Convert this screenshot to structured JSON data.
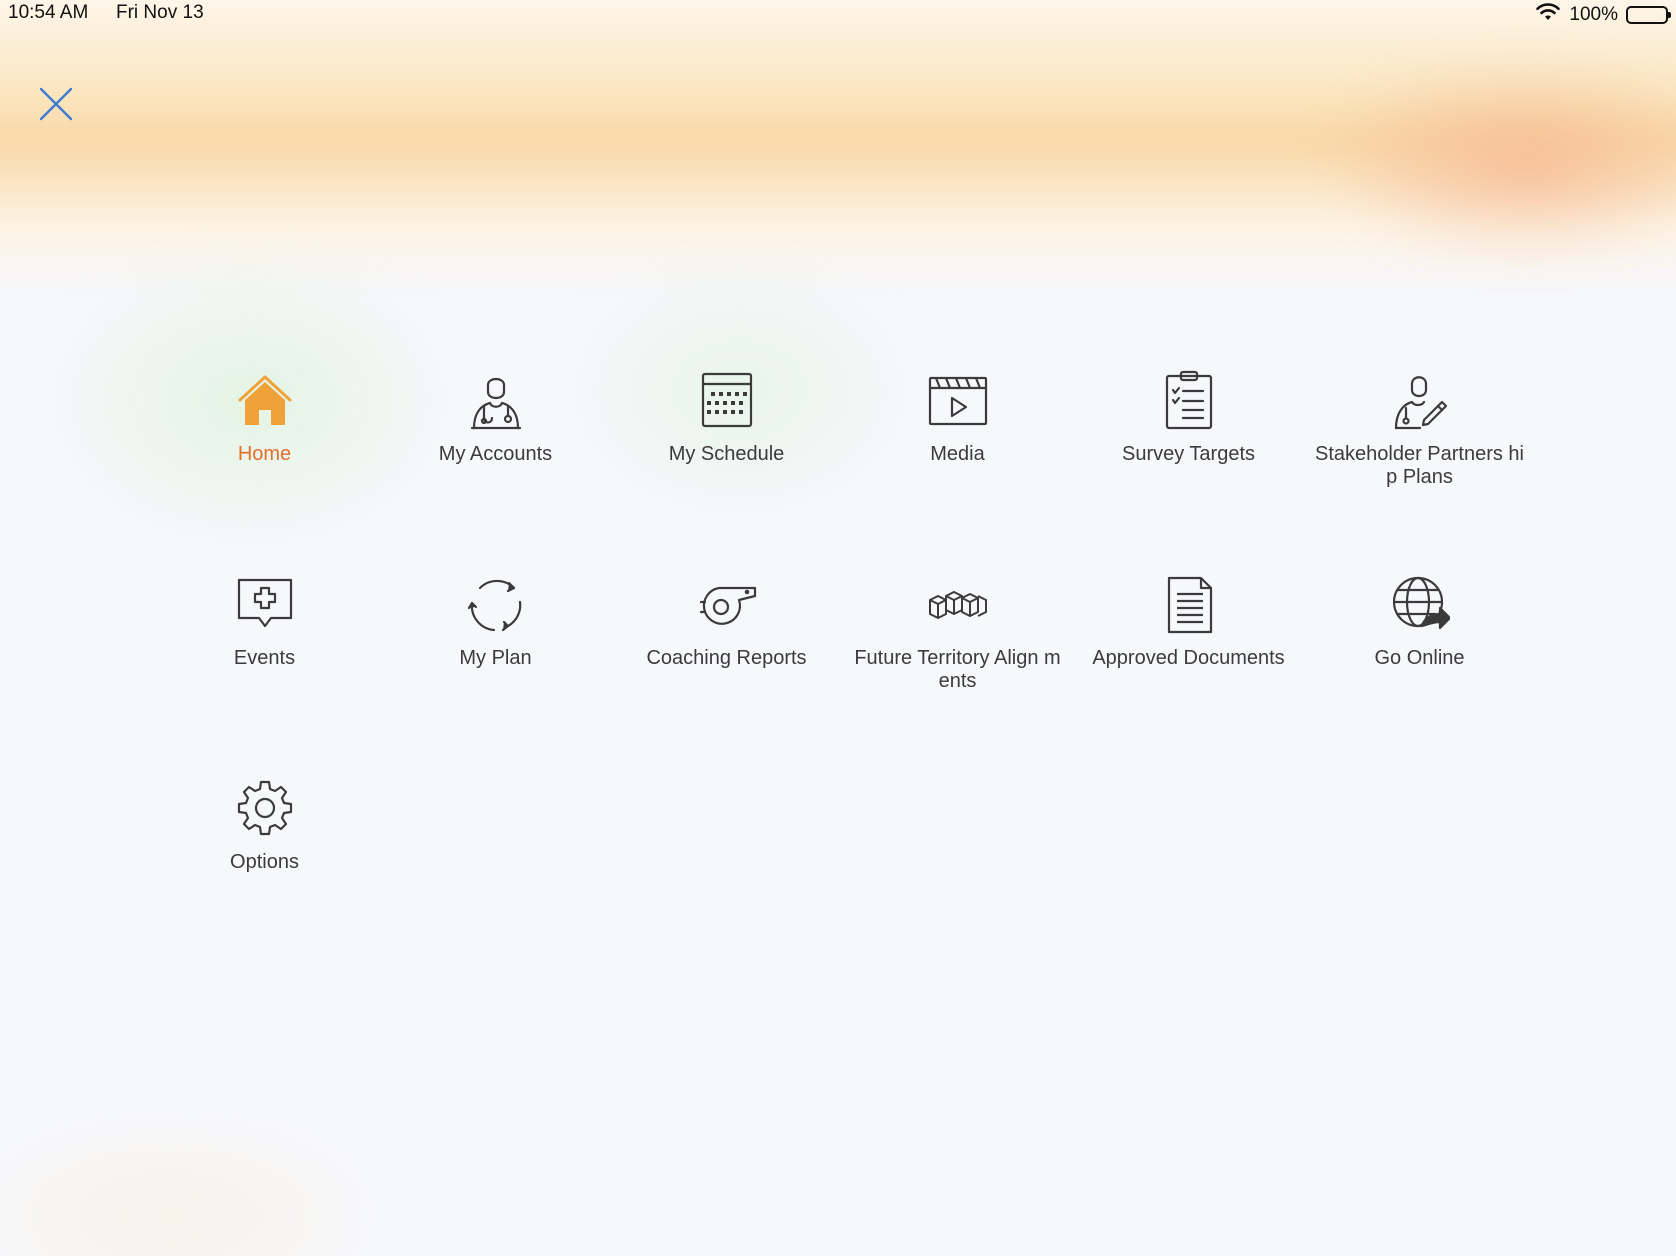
{
  "status_bar": {
    "time": "10:54 AM",
    "date": "Fri Nov 13",
    "battery": "100%"
  },
  "close_icon": "close-icon",
  "colors": {
    "active_label": "#e36f2b",
    "active_icon": "#f0a23a",
    "icon_stroke": "#3b3b3b",
    "close_icon": "#3a7bd5"
  },
  "menu": {
    "items": [
      {
        "label": "Home",
        "icon": "home-icon",
        "active": true
      },
      {
        "label": "My Accounts",
        "icon": "doctor-icon"
      },
      {
        "label": "My Schedule",
        "icon": "calendar-icon"
      },
      {
        "label": "Media",
        "icon": "clapperboard-icon"
      },
      {
        "label": "Survey Targets",
        "icon": "clipboard-checklist-icon"
      },
      {
        "label": "Stakeholder Partners hip Plans",
        "icon": "person-edit-icon"
      },
      {
        "label": "Events",
        "icon": "medical-chat-icon"
      },
      {
        "label": "My Plan",
        "icon": "refresh-cycle-icon"
      },
      {
        "label": "Coaching Reports",
        "icon": "whistle-icon"
      },
      {
        "label": "Future Territory Align ments",
        "icon": "cubes-icon"
      },
      {
        "label": "Approved Documents",
        "icon": "document-icon"
      },
      {
        "label": "Go Online",
        "icon": "globe-arrow-icon"
      },
      {
        "label": "Options",
        "icon": "gear-icon"
      }
    ]
  }
}
